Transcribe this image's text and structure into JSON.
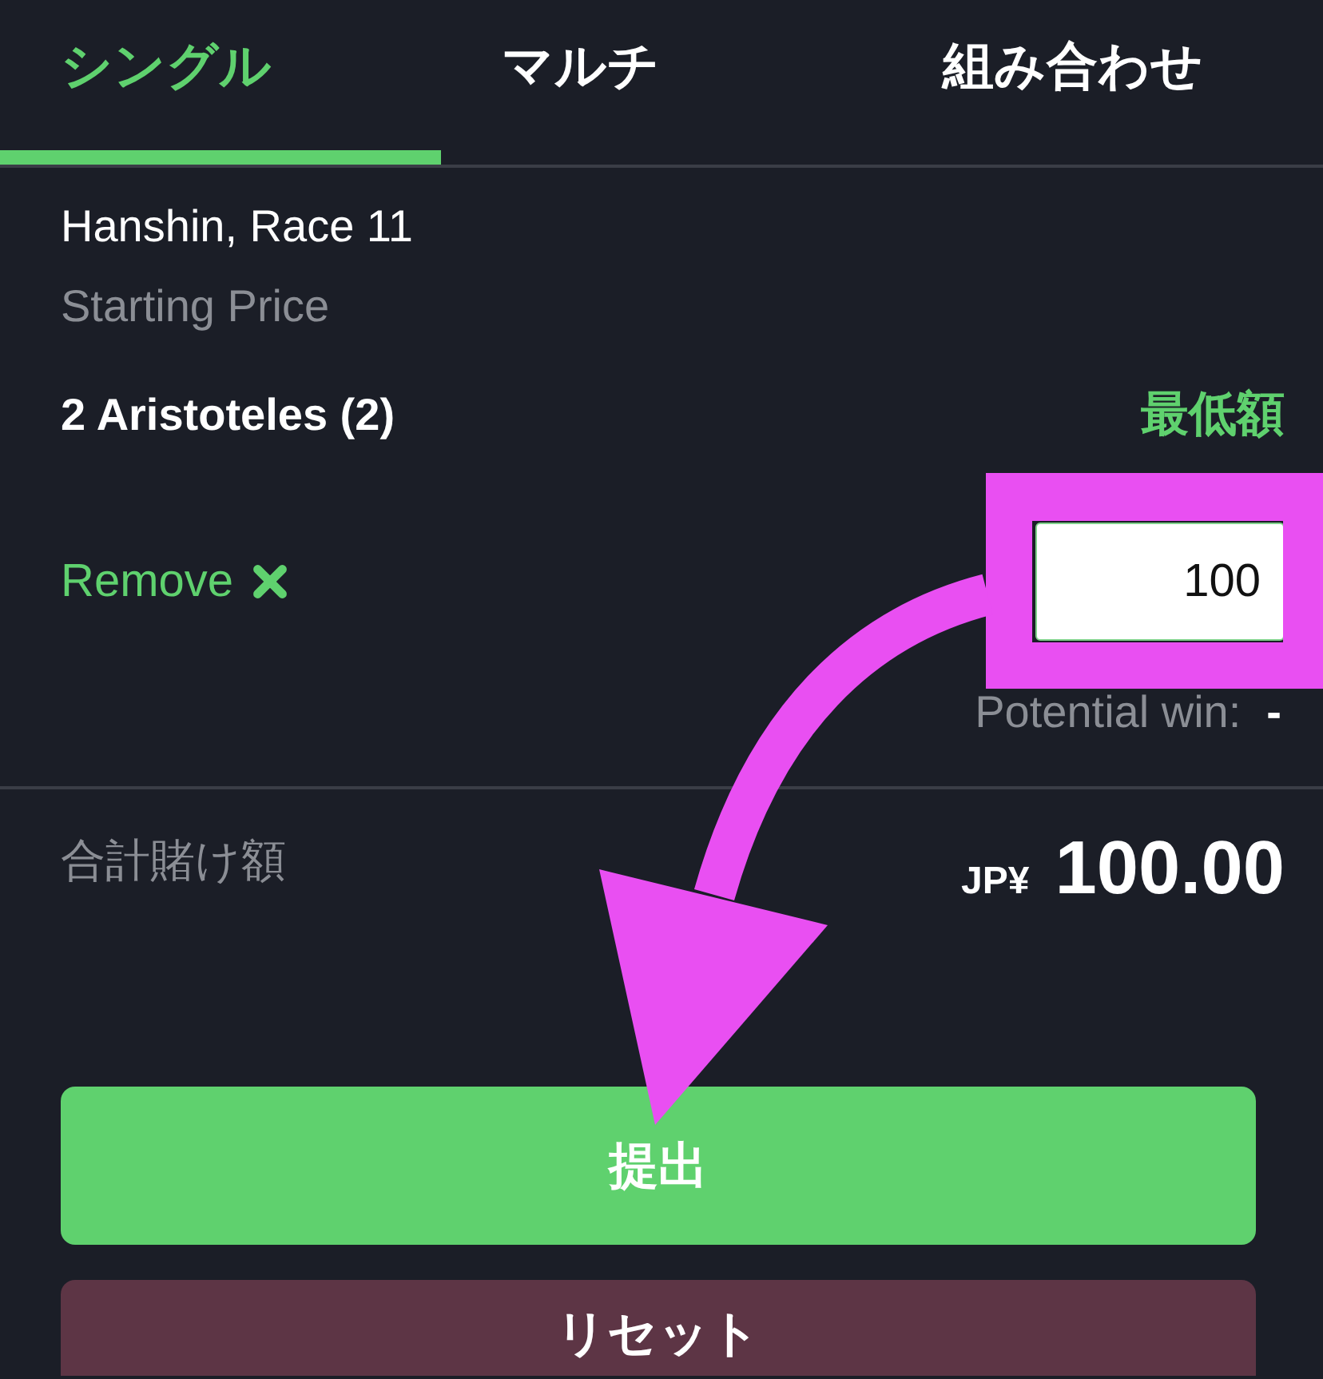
{
  "tabs": [
    {
      "label": "シングル",
      "selected": true
    },
    {
      "label": "マルチ",
      "selected": false
    },
    {
      "label": "組み合わせ",
      "selected": false
    }
  ],
  "bet": {
    "event": "Hanshin, Race 11",
    "price_type": "Starting Price",
    "selection": "2 Aristoteles (2)",
    "min_stake_link": "最低額",
    "remove_link": "Remove",
    "stake": {
      "value": "100"
    },
    "potential_win_label": "Potential win:",
    "potential_win_value": "-"
  },
  "total": {
    "label": "合計賭け額",
    "currency": "JP¥",
    "amount": "100.00"
  },
  "buttons": [
    {
      "label": "提出",
      "kind": "submit"
    },
    {
      "label": "リセット",
      "kind": "reset"
    }
  ]
}
